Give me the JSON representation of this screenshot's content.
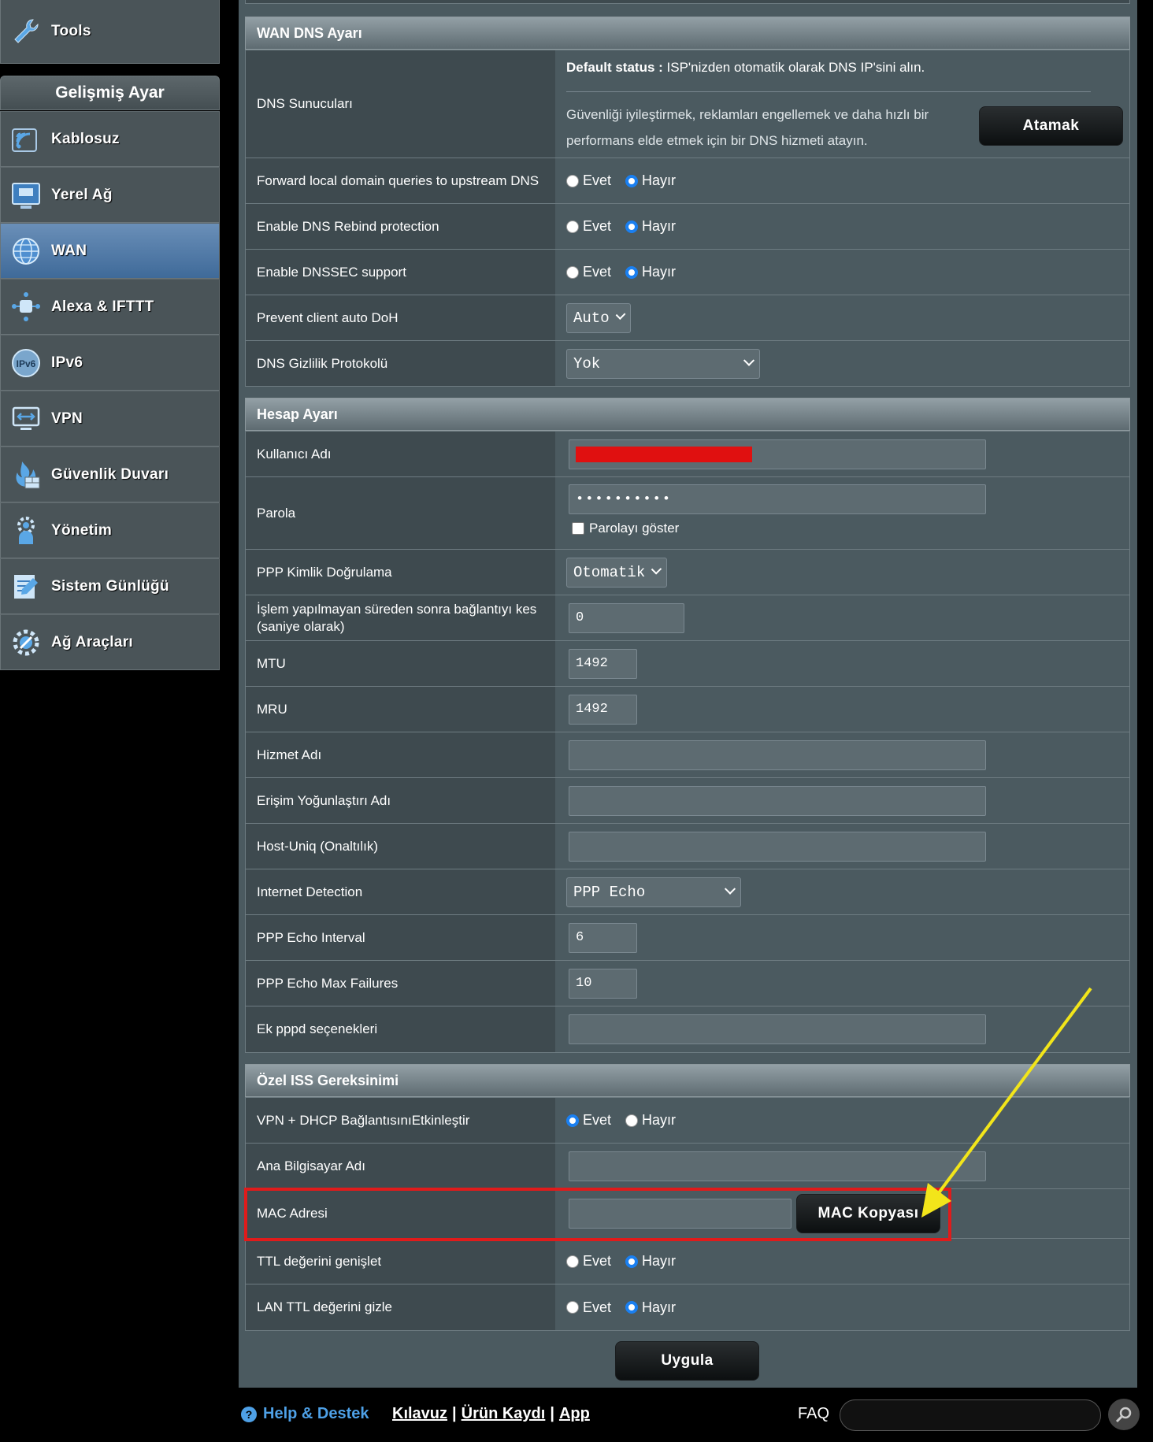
{
  "sidebar": {
    "tools_label": "Tools",
    "header": "Gelişmiş Ayar",
    "items": [
      {
        "label": "Kablosuz",
        "icon": "wireless-icon"
      },
      {
        "label": "Yerel Ağ",
        "icon": "lan-icon"
      },
      {
        "label": "WAN",
        "icon": "globe-icon"
      },
      {
        "label": "Alexa & IFTTT",
        "icon": "alexa-icon"
      },
      {
        "label": "IPv6",
        "icon": "ipv6-icon"
      },
      {
        "label": "VPN",
        "icon": "vpn-icon"
      },
      {
        "label": "Güvenlik Duvarı",
        "icon": "firewall-icon"
      },
      {
        "label": "Yönetim",
        "icon": "admin-icon"
      },
      {
        "label": "Sistem Günlüğü",
        "icon": "log-icon"
      },
      {
        "label": "Ağ Araçları",
        "icon": "network-tools-icon"
      }
    ],
    "active_item": "WAN"
  },
  "dns_section": {
    "title": "WAN DNS Ayarı",
    "dns_server_label": "DNS Sunucuları",
    "default_status_bold": "Default status :",
    "default_status_text": " ISP'nizden otomatik olarak DNS IP'sini alın.",
    "dns_service_text_1": "Güvenliği iyileştirmek, reklamları engellemek ve daha hızlı bir",
    "dns_service_text_2": "performans elde etmek için bir DNS hizmeti atayın.",
    "assign_button": "Atamak",
    "forward_label": "Forward local domain queries to upstream DNS",
    "rebind_label": "Enable DNS Rebind protection",
    "dnssec_label": "Enable DNSSEC support",
    "doh_label": "Prevent client auto DoH",
    "doh_value": "Auto",
    "privacy_label": "DNS Gizlilik Protokolü",
    "privacy_value": "Yok"
  },
  "radio": {
    "yes": "Evet",
    "no": "Hayır"
  },
  "account_section": {
    "title": "Hesap Ayarı",
    "username_label": "Kullanıcı Adı",
    "password_label": "Parola",
    "password_value": "••••••••••",
    "show_password_label": "Parolayı göster",
    "auth_label": "PPP Kimlik Doğrulama",
    "auth_value": "Otomatik",
    "idle_label": "İşlem yapılmayan süreden sonra bağlantıyı kes (saniye olarak)",
    "idle_value": "0",
    "mtu_label": "MTU",
    "mtu_value": "1492",
    "mru_label": "MRU",
    "mru_value": "1492",
    "service_label": "Hizmet Adı",
    "concentrator_label": "Erişim Yoğunlaştırı Adı",
    "hostuniq_label": "Host-Uniq (Onaltılık)",
    "detection_label": "Internet Detection",
    "detection_value": "PPP Echo",
    "echo_interval_label": "PPP Echo Interval",
    "echo_interval_value": "6",
    "echo_failures_label": "PPP Echo Max Failures",
    "echo_failures_value": "10",
    "pppd_label": "Ek pppd seçenekleri"
  },
  "isp_section": {
    "title": "Özel ISS Gereksinimi",
    "vpn_dhcp_label": "VPN + DHCP BağlantısınıEtkinleştir",
    "hostname_label": "Ana Bilgisayar Adı",
    "mac_label": "MAC Adresi",
    "mac_clone_button": "MAC Kopyası",
    "ttl_extend_label": "TTL değerini genişlet",
    "lan_ttl_label": "LAN TTL değerini gizle"
  },
  "apply_button": "Uygula",
  "footer": {
    "help": "Help & Destek",
    "manual": "Kılavuz",
    "separator": "|",
    "registration": "Ürün Kaydı",
    "app": "App",
    "faq": "FAQ"
  },
  "colors": {
    "highlight_box": "#e01b1b",
    "arrow": "#f2e51a",
    "redacted": "#e01010",
    "radio_selected": "#1a7ff0"
  }
}
